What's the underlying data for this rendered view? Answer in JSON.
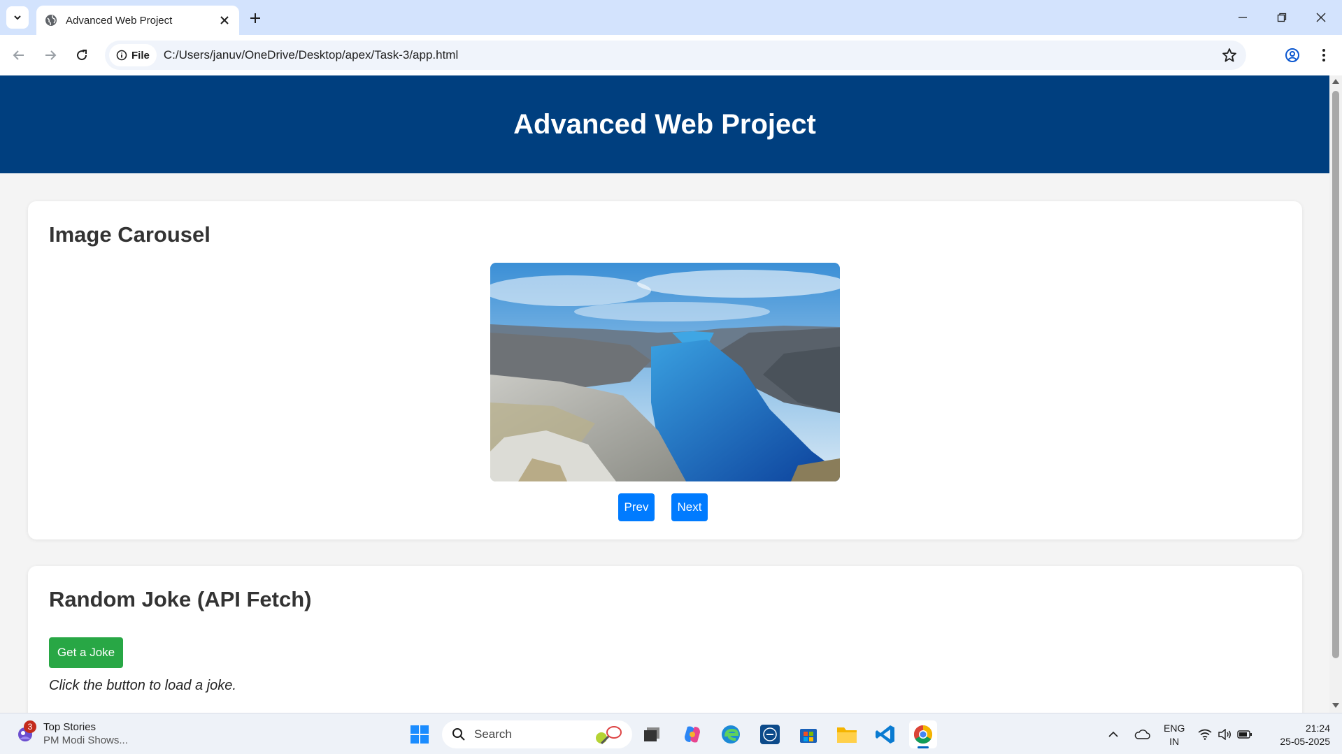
{
  "browser": {
    "tab_title": "Advanced Web Project",
    "chip_label": "File",
    "url": "C:/Users/januv/OneDrive/Desktop/apex/Task-3/app.html"
  },
  "page": {
    "header_title": "Advanced Web Project",
    "carousel": {
      "heading": "Image Carousel",
      "prev_label": "Prev",
      "next_label": "Next"
    },
    "joke": {
      "heading": "Random Joke (API Fetch)",
      "button_label": "Get a Joke",
      "text": "Click the button to load a joke."
    }
  },
  "taskbar": {
    "news_badge": "3",
    "news_title": "Top Stories",
    "news_subtitle": "PM Modi Shows...",
    "search_label": "Search",
    "lang_top": "ENG",
    "lang_bottom": "IN",
    "time": "21:24",
    "date": "25-05-2025"
  },
  "colors": {
    "header_bg": "#003f7f",
    "primary_button": "#007bff",
    "success_button": "#28a745",
    "page_bg": "#f4f4f4"
  }
}
